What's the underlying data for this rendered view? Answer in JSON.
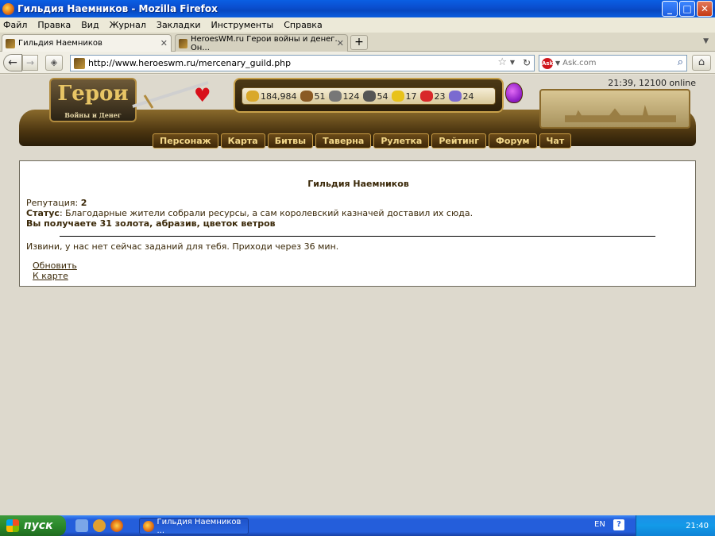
{
  "window": {
    "title": "Гильдия Наемников - Mozilla Firefox",
    "buttons": [
      "_",
      "□",
      "✕"
    ]
  },
  "menubar": [
    "Файл",
    "Правка",
    "Вид",
    "Журнал",
    "Закладки",
    "Инструменты",
    "Справка"
  ],
  "tabs": [
    {
      "label": "Гильдия Наемников",
      "active": true
    },
    {
      "label": "HeroesWM.ru Герои войны и денег. Он...",
      "active": false
    }
  ],
  "navbar": {
    "url": "http://www.heroeswm.ru/mercenary_guild.php",
    "search_placeholder": "Ask.com",
    "search_engine_icon": "ask-icon"
  },
  "game": {
    "logo_title": "Герои",
    "logo_sub": "Войны и Денег",
    "status": "21:39, 12100 online",
    "resources": [
      {
        "icon": "gold-icon",
        "value": "184,984",
        "color": "#d9a82a"
      },
      {
        "icon": "wood-icon",
        "value": "51",
        "color": "#8a5a24"
      },
      {
        "icon": "ore-icon",
        "value": "124",
        "color": "#777777"
      },
      {
        "icon": "mercury-icon",
        "value": "54",
        "color": "#555555"
      },
      {
        "icon": "sulfur-icon",
        "value": "17",
        "color": "#e8c21a"
      },
      {
        "icon": "crystal-icon",
        "value": "23",
        "color": "#d8282a"
      },
      {
        "icon": "gems-icon",
        "value": "24",
        "color": "#7a6ad0"
      }
    ],
    "nav": [
      "Персонаж",
      "Карта",
      "Битвы",
      "Таверна",
      "Рулетка",
      "Рейтинг",
      "Форум",
      "Чат"
    ]
  },
  "content": {
    "heading": "Гильдия Наемников",
    "reputation_label": "Репутация:",
    "reputation_value": "2",
    "status_label": "Статус",
    "status_text": ": Благодарные жители собрали ресурсы, а сам королевский казначей доставил их сюда.",
    "reward": "Вы получаете 31 золота, абразив, цветок ветров",
    "no_tasks": "Извини, у нас нет сейчас заданий для тебя. Приходи через 36 мин.",
    "link_refresh": "Обновить",
    "link_map": "К карте"
  },
  "taskbar": {
    "start_label": "пуск",
    "task_label": "Гильдия Наемников ...",
    "language": "EN",
    "clock": "21:40"
  }
}
